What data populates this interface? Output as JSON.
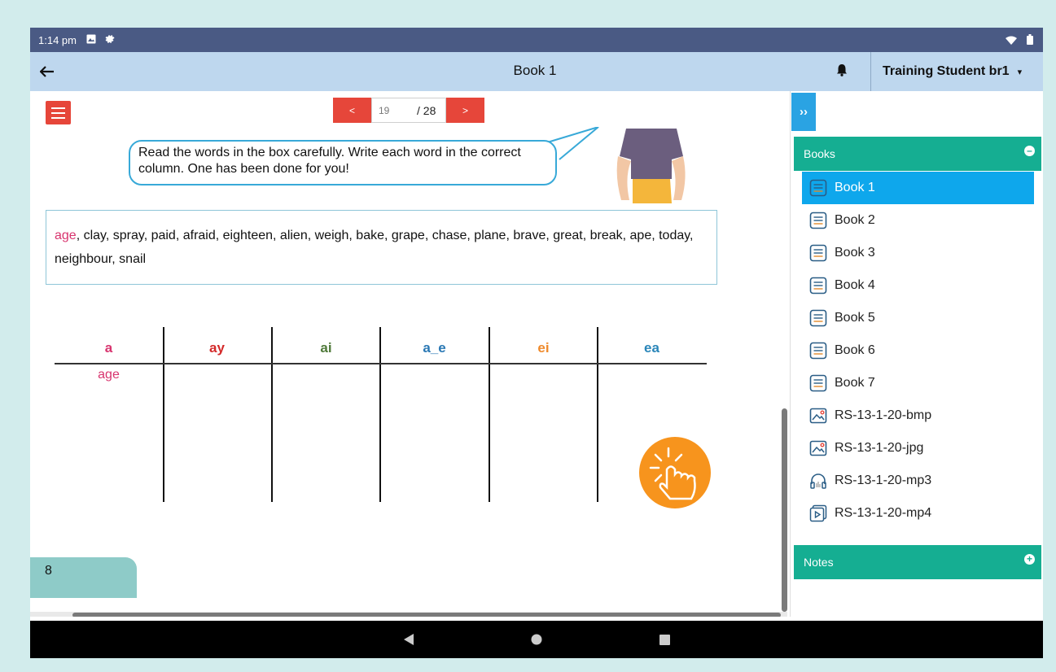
{
  "status_bar": {
    "time": "1:14 pm"
  },
  "app_bar": {
    "back_icon": "arrow-left-icon",
    "title": "Book 1",
    "user_name": "Training Student br1",
    "caret": "▾"
  },
  "pager": {
    "prev_label": "<",
    "page_value": "19",
    "total_label": "/ 28",
    "next_label": ">"
  },
  "worksheet": {
    "instruction": "Read the words in the box carefully. Write each word in the correct column. One has been done for you!",
    "first_word": "age",
    "word_list": ", clay, spray, paid, afraid, eighteen, alien, weigh, bake, grape, chase, plane, brave, great, break, ape, today, neighbour, snail",
    "columns": [
      {
        "label": "a",
        "color": "#d8346e"
      },
      {
        "label": "ay",
        "color": "#d42a2a"
      },
      {
        "label": "ai",
        "color": "#4f7a3a"
      },
      {
        "label": "a_e",
        "color": "#2a78b4"
      },
      {
        "label": "ei",
        "color": "#ef8a2c"
      },
      {
        "label": "ea",
        "color": "#2a86b9"
      }
    ],
    "example_entry": "age",
    "page_number": "8"
  },
  "sidebar": {
    "collapse_label": "››",
    "books_header": "Books",
    "notes_header": "Notes",
    "items": [
      {
        "label": "Book 1",
        "icon": "book-icon",
        "active": true
      },
      {
        "label": "Book 2",
        "icon": "book-icon"
      },
      {
        "label": "Book 3",
        "icon": "book-icon"
      },
      {
        "label": "Book 4",
        "icon": "book-icon"
      },
      {
        "label": "Book 5",
        "icon": "book-icon"
      },
      {
        "label": "Book 6",
        "icon": "book-icon"
      },
      {
        "label": "Book 7",
        "icon": "book-icon"
      },
      {
        "label": "RS-13-1-20-bmp",
        "icon": "image-icon"
      },
      {
        "label": "RS-13-1-20-jpg",
        "icon": "image-icon"
      },
      {
        "label": "RS-13-1-20-mp3",
        "icon": "headphones-icon"
      },
      {
        "label": "RS-13-1-20-mp4",
        "icon": "video-icon"
      }
    ]
  },
  "colors": {
    "accent_red": "#e6463a",
    "panel_green": "#15ae92",
    "active_blue": "#0ea7ec",
    "app_bar_bg": "#bed7ee"
  }
}
